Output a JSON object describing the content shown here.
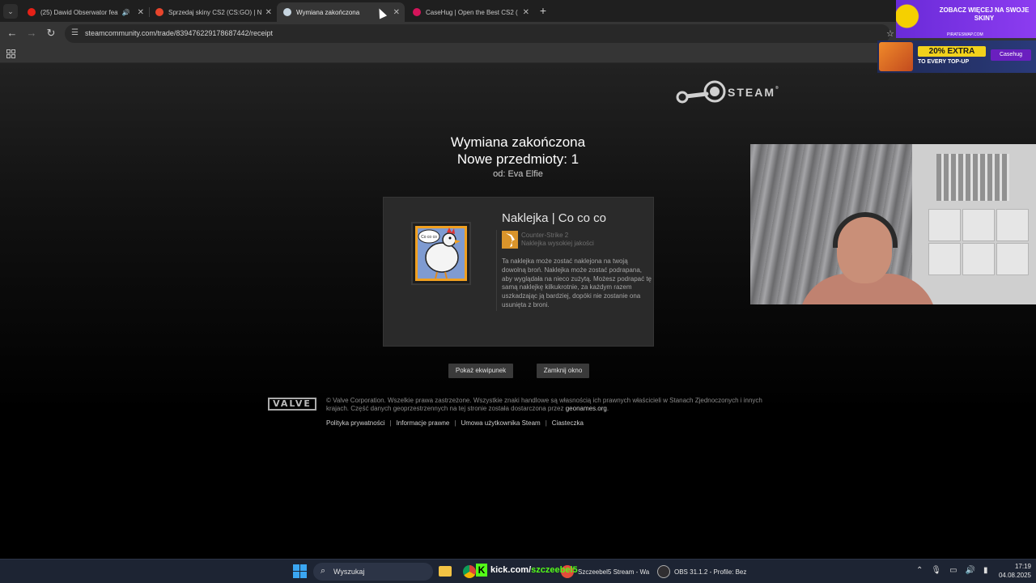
{
  "browser": {
    "tabs": [
      {
        "title": "(25) Dawid Obserwator feat",
        "favicon_color": "#e62117",
        "muted_icon": "speaker-icon"
      },
      {
        "title": "Sprzedaj skiny CS2 (CS:GO) | N",
        "favicon_color": "#e8452c"
      },
      {
        "title": "Wymiana zakończona",
        "favicon_color": "#c7d5e0",
        "active": true
      },
      {
        "title": "CaseHug | Open the Best CS2 (",
        "favicon_color": "#d4145a"
      }
    ],
    "close_glyph": "✕",
    "new_tab_glyph": "+",
    "url": "steamcommunity.com/trade/839476229178687442/receipt"
  },
  "steam_header": {
    "wordmark": "STEAM",
    "tm": "®"
  },
  "receipt": {
    "title": "Wymiana zakończona",
    "subtitle": "Nowe przedmioty: 1",
    "from": "od: Eva Elfie",
    "item": {
      "name": "Naklejka | Co co co",
      "game": "Counter-Strike 2",
      "type": "Naklejka wysokiej jakości",
      "description": "Ta naklejka może zostać naklejona na twoją dowolną broń. Naklejka może zostać podrapana, aby wyglądała na nieco zużytą. Możesz podrapać tę samą naklejkę kilkukrotnie, za każdym razem uszkadzając ją bardziej, dopóki nie zostanie ona usunięta z broni.",
      "sticker_text": "Co co co"
    },
    "buttons": {
      "inventory": "Pokaż ekwipunek",
      "close": "Zamknij okno"
    }
  },
  "footer": {
    "valve_logo": "VALVE",
    "legal": "© Valve Corporation. Wszelkie prawa zastrzeżone. Wszystkie znaki handlowe są własnością ich prawnych właścicieli w Stanach Zjednoczonych i innych krajach. Część danych geoprzestrzennych na tej stronie została dostarczona przez ",
    "geonames": "geonames.org",
    "links": [
      "Polityka prywatności",
      "Informacje prawne",
      "Umowa użytkownika Steam",
      "Ciasteczka"
    ],
    "separator": "|"
  },
  "ads": {
    "top_text": "ZOBACZ WIĘCEJ NA SWOJE SKINY",
    "top_sub": "PIRATESWAP.COM",
    "mid_badge": "20% EXTRA",
    "mid_text": "TO EVERY TOP-UP",
    "mid_brand": "Casehug"
  },
  "taskbar": {
    "search_placeholder": "Wyszukaj",
    "kick_text": "kick.com/",
    "kick_user": "szczeebel5",
    "apps": [
      {
        "label": "Szczeebel5 Stream - Wa",
        "icon_color": "#e44d3a"
      },
      {
        "label": "OBS 31.1.2 - Profile: Bez",
        "icon_color": "#302e31"
      }
    ],
    "time": "17:19",
    "date": "04.08.2025"
  },
  "colors": {
    "accent_kick": "#53fc18",
    "steam_panel": "#2a2a2a",
    "tab_bar": "#1f1f1f"
  }
}
